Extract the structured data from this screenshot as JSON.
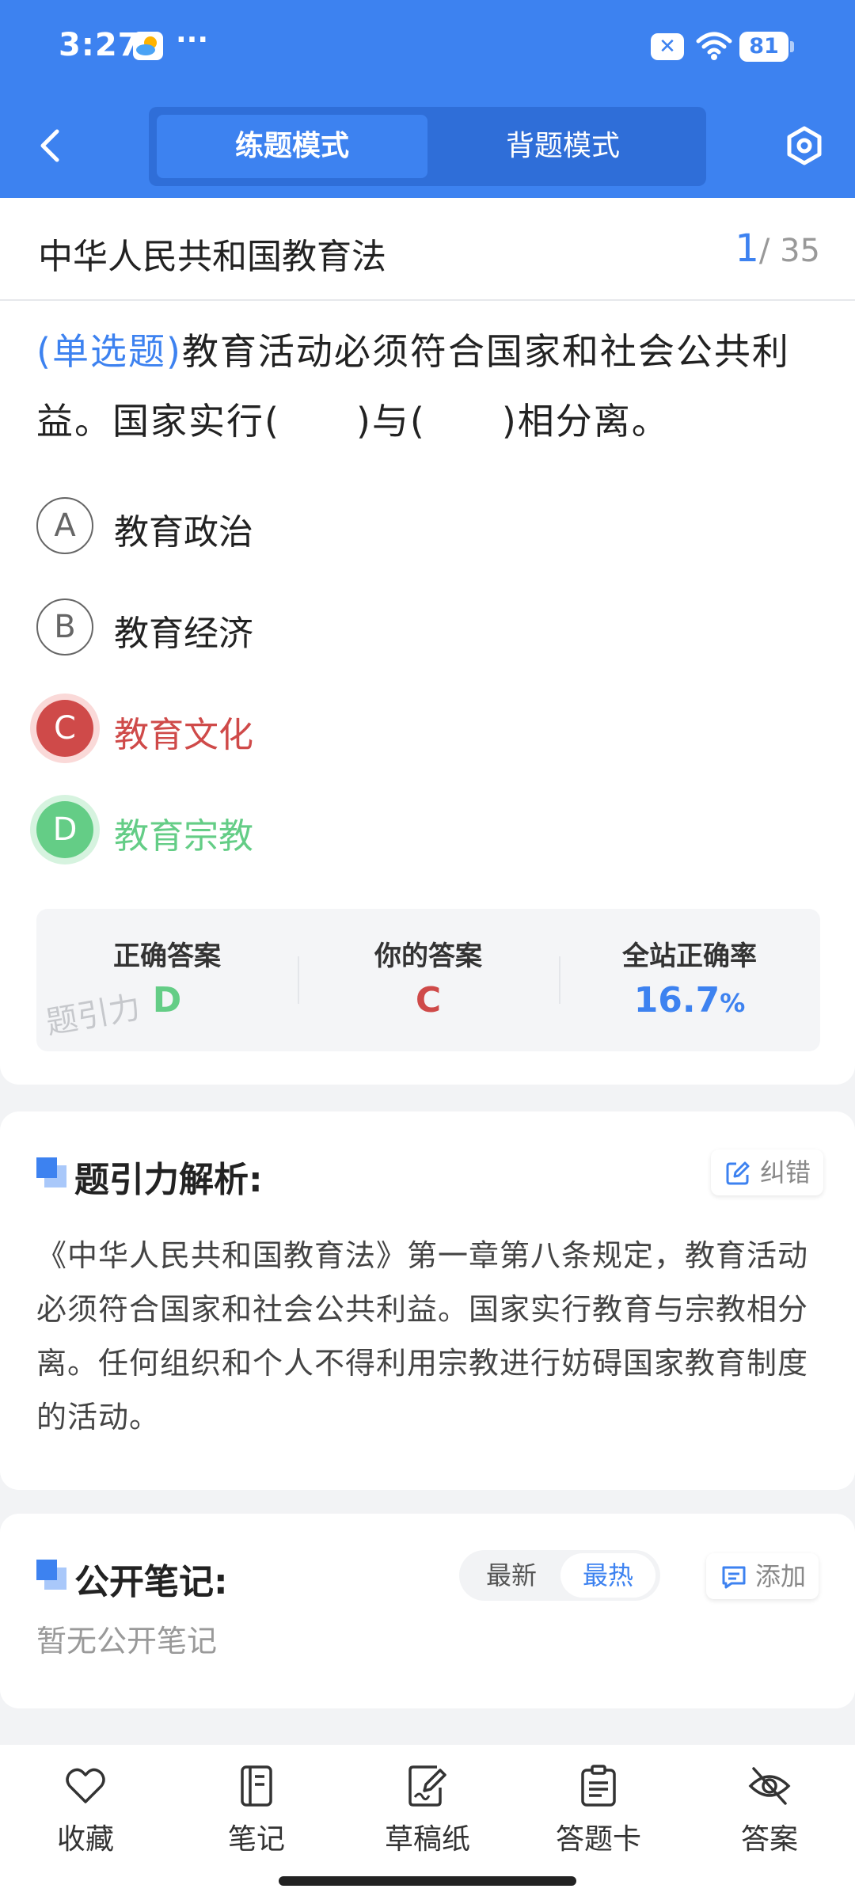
{
  "status_bar": {
    "time": "3:27",
    "more": "···",
    "notification_badge": "✕",
    "battery": "81"
  },
  "header": {
    "tabs": [
      {
        "label": "练题模式",
        "active": true
      },
      {
        "label": "背题模式",
        "active": false
      }
    ]
  },
  "subject": {
    "title": "中华人民共和国教育法",
    "current": "1",
    "total": "/ 35"
  },
  "question": {
    "type": "(单选题)",
    "text": "教育活动必须符合国家和社会公共利益。国家实行(　　)与(　　)相分离。",
    "options": [
      {
        "letter": "A",
        "text": "教育政治",
        "state": "normal"
      },
      {
        "letter": "B",
        "text": "教育经济",
        "state": "normal"
      },
      {
        "letter": "C",
        "text": "教育文化",
        "state": "wrong"
      },
      {
        "letter": "D",
        "text": "教育宗教",
        "state": "correct"
      }
    ]
  },
  "stats": {
    "correct_label": "正确答案",
    "correct_value": "D",
    "yours_label": "你的答案",
    "yours_value": "C",
    "rate_label": "全站正确率",
    "rate_value": "16.7",
    "rate_unit": "%",
    "watermark": "题引力"
  },
  "analysis": {
    "title": "题引力解析:",
    "report_label": "纠错",
    "text": "《中华人民共和国教育法》第一章第八条规定，教育活动必须符合国家和社会公共利益。国家实行教育与宗教相分离。任何组织和个人不得利用宗教进行妨碍国家教育制度的活动。"
  },
  "notes": {
    "title": "公开笔记:",
    "sort_newest": "最新",
    "sort_hottest": "最热",
    "add_label": "添加",
    "empty": "暂无公开笔记"
  },
  "bottom_bar": [
    {
      "label": "收藏",
      "icon": "heart-icon"
    },
    {
      "label": "笔记",
      "icon": "notebook-icon"
    },
    {
      "label": "草稿纸",
      "icon": "draft-paper-icon"
    },
    {
      "label": "答题卡",
      "icon": "answer-sheet-icon"
    },
    {
      "label": "答案",
      "icon": "eye-off-icon"
    }
  ],
  "colors": {
    "primary": "#3d82f0",
    "wrong": "#cf4a49",
    "correct": "#64cd86"
  }
}
